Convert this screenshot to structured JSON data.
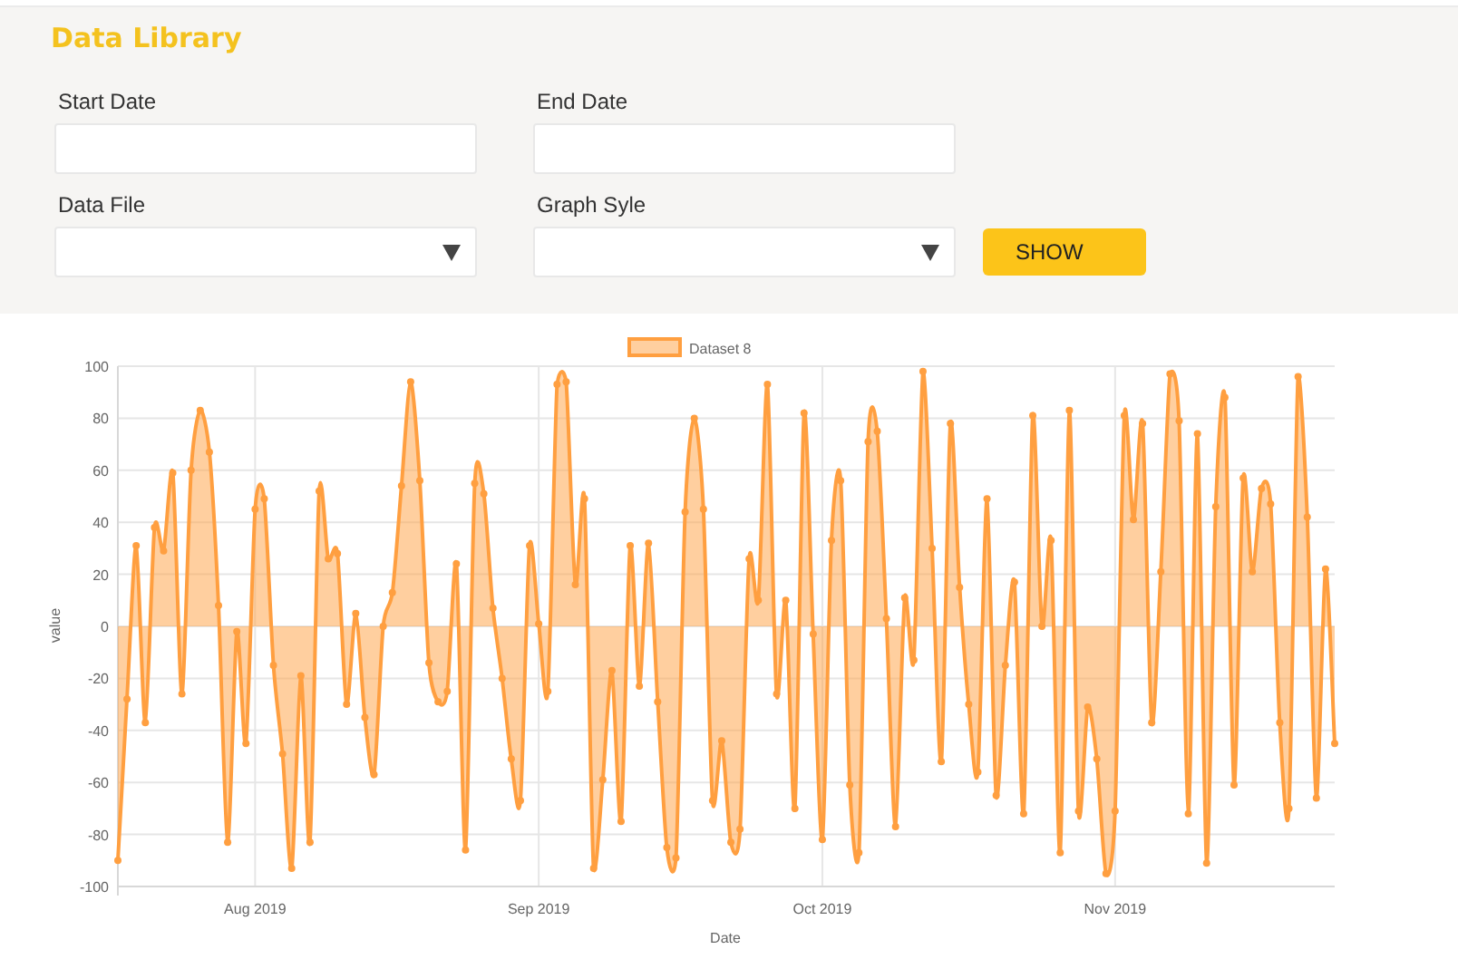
{
  "header": {
    "title": "Data Library",
    "fields": [
      {
        "label": "Start Date",
        "kind": "text"
      },
      {
        "label": "End Date",
        "kind": "text"
      },
      {
        "label": "Data File",
        "kind": "select"
      },
      {
        "label": "Graph Syle",
        "kind": "select"
      }
    ],
    "button": "SHOW"
  },
  "chart": {
    "chart_data": {
      "type": "area",
      "xlabel": "Date",
      "ylabel": "value",
      "grid": true,
      "categories": [
        null,
        null,
        null,
        null,
        null,
        null,
        null,
        null,
        null,
        null,
        null,
        null,
        null,
        null,
        null,
        "Aug 2019",
        null,
        null,
        null,
        null,
        null,
        null,
        null,
        null,
        null,
        null,
        null,
        null,
        null,
        null,
        null,
        null,
        null,
        null,
        null,
        null,
        null,
        null,
        null,
        null,
        null,
        null,
        null,
        null,
        null,
        null,
        "Sep 2019",
        null,
        null,
        null,
        null,
        null,
        null,
        null,
        null,
        null,
        null,
        null,
        null,
        null,
        null,
        null,
        null,
        null,
        null,
        null,
        null,
        null,
        null,
        null,
        null,
        null,
        null,
        null,
        null,
        null,
        null,
        "Oct 2019",
        null,
        null,
        null,
        null,
        null,
        null,
        null,
        null,
        null,
        null,
        null,
        null,
        null,
        null,
        null,
        null,
        null,
        null,
        null,
        null,
        null,
        null,
        null,
        null,
        null,
        null,
        null,
        null,
        null,
        null,
        null,
        "Nov 2019",
        null,
        null,
        null,
        null,
        null,
        null,
        null,
        null,
        null,
        null,
        null,
        null,
        null,
        null,
        null,
        null,
        null,
        null,
        null,
        null,
        null,
        null,
        null,
        null
      ],
      "ylim": [
        -100,
        100
      ],
      "yticks": [
        -100,
        -80,
        -60,
        -40,
        -20,
        0,
        20,
        40,
        60,
        80,
        100
      ],
      "series": [
        {
          "name": "Dataset 8",
          "color": "#ff9f40",
          "values": [
            -90,
            -28,
            31,
            -37,
            38,
            29,
            59,
            -26,
            60,
            83,
            67,
            8,
            -83,
            -2,
            -45,
            45,
            49,
            -15,
            -49,
            -93,
            -19,
            -83,
            52,
            26,
            28,
            -30,
            5,
            -35,
            -57,
            0,
            13,
            54,
            94,
            56,
            -14,
            -29,
            -25,
            24,
            -86,
            55,
            51,
            7,
            -20,
            -51,
            -67,
            31,
            1,
            -25,
            93,
            94,
            16,
            49,
            -93,
            -59,
            -17,
            -75,
            31,
            -23,
            32,
            -29,
            -85,
            -89,
            44,
            80,
            45,
            -67,
            -44,
            -83,
            -78,
            26,
            10,
            93,
            -26,
            10,
            -70,
            82,
            -3,
            -82,
            33,
            56,
            -61,
            -87,
            71,
            75,
            3,
            -77,
            11,
            -13,
            98,
            30,
            -52,
            78,
            15,
            -30,
            -56,
            49,
            -65,
            -15,
            17,
            -72,
            81,
            0,
            33,
            -87,
            83,
            -71,
            -31,
            -51,
            -95,
            -71,
            81,
            41,
            78,
            -37,
            21,
            97,
            79,
            -72,
            74,
            -91,
            46,
            88,
            -61,
            57,
            21,
            53,
            47,
            -37,
            -70,
            96,
            42,
            -66,
            22,
            -45
          ]
        }
      ]
    }
  }
}
